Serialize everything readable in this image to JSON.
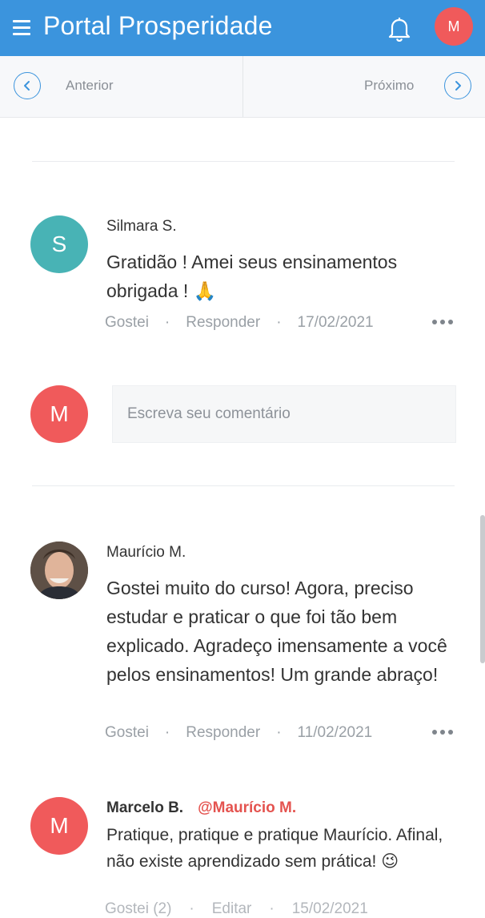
{
  "header": {
    "title": "Portal Prosperidade",
    "avatar_initial": "M",
    "color": "#3b94dd"
  },
  "nav": {
    "prev_label": "Anterior",
    "next_label": "Próximo"
  },
  "comments": [
    {
      "author": "Silmara S.",
      "initial": "S",
      "avatar_color": "#48b3b5",
      "text": "Gratidão ! Amei seus ensinamentos obrigada ! 🙏",
      "like": "Gostei",
      "reply": "Responder",
      "date": "17/02/2021"
    },
    {
      "author": "Maurício M.",
      "text": "Gostei muito do curso! Agora, preciso estudar e praticar o que foi tão bem explicado. Agradeço imensamente a você pelos ensinamentos! Um grande abraço!",
      "like": "Gostei",
      "reply": "Responder",
      "date": "11/02/2021"
    }
  ],
  "composer": {
    "initial": "M",
    "avatar_color": "#f05a5b",
    "placeholder": "Escreva seu comentário"
  },
  "reply": {
    "author": "Marcelo B.",
    "initial": "M",
    "mention": "@Maurício M.",
    "text": "Pratique, pratique e pratique Maurício. Afinal, não existe aprendizado sem prática! 😉",
    "meta_like": "Gostei (2)",
    "meta_edit": "Editar",
    "date": "15/02/2021"
  }
}
